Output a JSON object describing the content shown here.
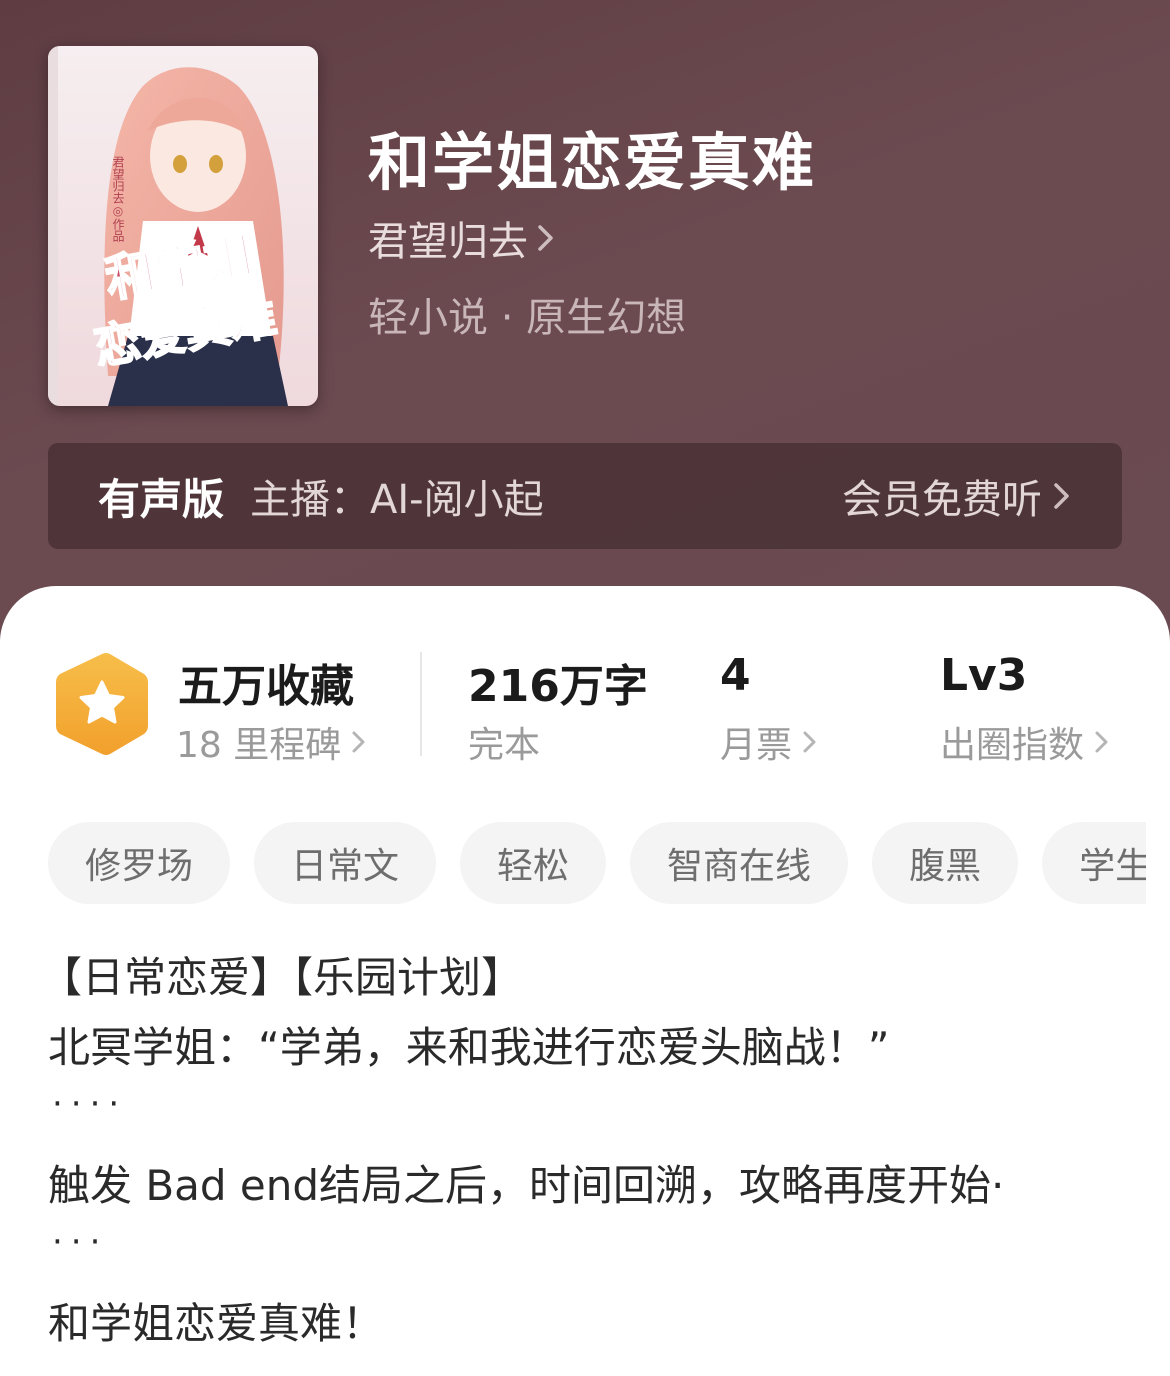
{
  "book": {
    "title": "和学姐恋爱真难",
    "author": "君望归去",
    "genre": "轻小说 · 原生幻想",
    "cover": {
      "title_line1": "和学姐",
      "title_line2": "恋爱真难",
      "author_credit": "君望归去◎作品"
    }
  },
  "audio": {
    "label": "有声版",
    "host": "主播：AI-阅小起",
    "action": "会员免费听"
  },
  "stats": {
    "collect_main": "五万收藏",
    "collect_sub": "18 里程碑",
    "words_main": "216万字",
    "words_sub": "完本",
    "tickets_main": "4",
    "tickets_sub": "月票",
    "level_main": "Lv3",
    "level_sub": "出圈指数"
  },
  "tags": [
    "修罗场",
    "日常文",
    "轻松",
    "智商在线",
    "腹黑",
    "学生"
  ],
  "description": {
    "line1": "【日常恋爱】【乐园计划】",
    "line2": "北冥学姐：“学弟，来和我进行恋爱头脑战！”",
    "ellipsis": "····",
    "line3": "触发 Bad end结局之后，时间回溯，攻略再度开始·",
    "ellipsis2": "···",
    "line4": "和学姐恋爱真难！"
  },
  "colors": {
    "hero_bg": "#6a4a50",
    "badge_orange": "#f4a935"
  }
}
